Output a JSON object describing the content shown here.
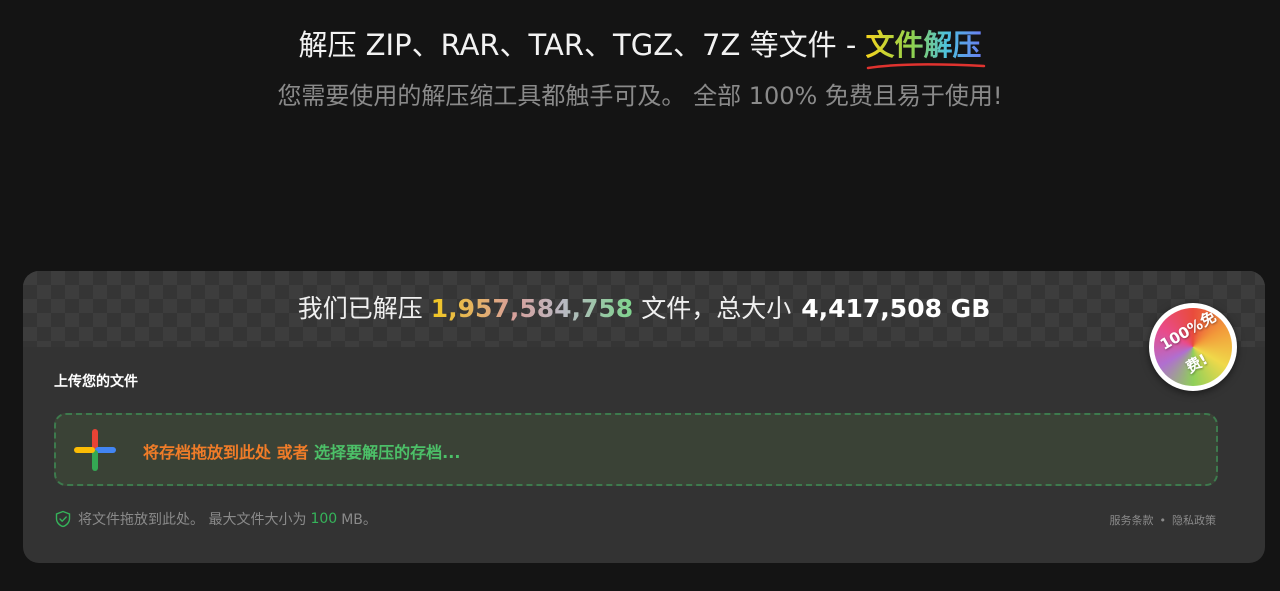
{
  "hero": {
    "title_prefix": "解压 ZIP、RAR、TAR、TGZ、7Z 等文件 - ",
    "title_highlight": "文件解压",
    "subtitle": "您需要使用的解压缩工具都触手可及。 全部 100% 免费且易于使用!"
  },
  "stats": {
    "prefix": "我们已解压",
    "file_count": "1,957,584,758",
    "middle": "文件，总大小",
    "total_size": "4,417,508 GB"
  },
  "badge": {
    "line1": "100%免",
    "line2": "费!"
  },
  "upload": {
    "title": "上传您的文件",
    "drop_text": "将存档拖放到此处 或者",
    "select_link": "选择要解压的存档..."
  },
  "footer": {
    "note_prefix": "将文件拖放到此处。 最大文件大小为",
    "max_size": "100",
    "unit": "MB。",
    "terms": "服务条款",
    "separator": "•",
    "privacy": "隐私政策"
  },
  "icons": {
    "plus": "plus-multicolor-icon",
    "shield": "shield-check-icon"
  },
  "colors": {
    "accent_orange": "#f07c28",
    "accent_green": "#4cc068",
    "card_bg": "#333333"
  }
}
